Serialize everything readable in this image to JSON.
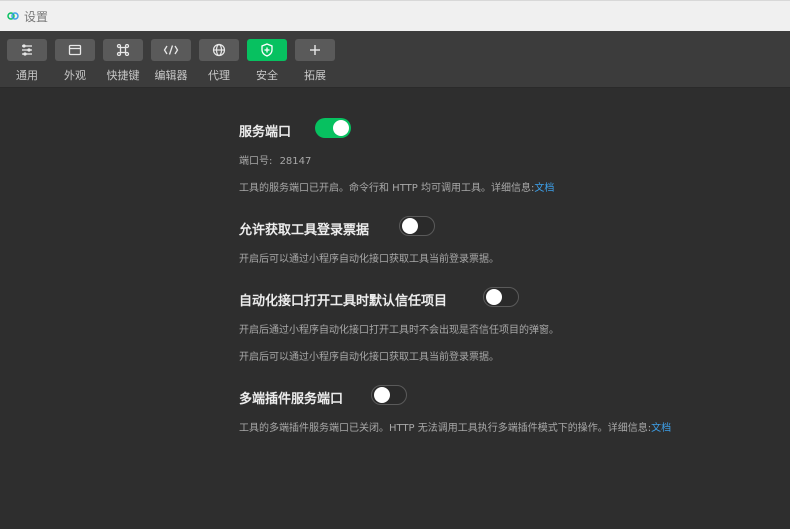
{
  "window": {
    "title": "设置"
  },
  "toolbar": {
    "items": [
      {
        "label": "通用",
        "icon": "list-settings-icon",
        "active": false
      },
      {
        "label": "外观",
        "icon": "window-icon",
        "active": false
      },
      {
        "label": "快捷键",
        "icon": "command-key-icon",
        "active": false
      },
      {
        "label": "编辑器",
        "icon": "code-icon",
        "active": false
      },
      {
        "label": "代理",
        "icon": "globe-icon",
        "active": false
      },
      {
        "label": "安全",
        "icon": "shield-icon",
        "active": true
      },
      {
        "label": "拓展",
        "icon": "plus-icon",
        "active": false
      }
    ]
  },
  "colors": {
    "accent": "#07c160",
    "link": "#3d9fe8",
    "background": "#2e2e2e",
    "toolbar": "#3c3c3c"
  },
  "settings": {
    "service_port": {
      "title": "服务端口",
      "enabled": true,
      "port_label": "端口号:",
      "port_value": "28147",
      "desc": "工具的服务端口已开启。命令行和 HTTP 均可调用工具。详细信息:",
      "link": "文档"
    },
    "login_ticket": {
      "title": "允许获取工具登录票据",
      "enabled": false,
      "desc": "开启后可以通过小程序自动化接口获取工具当前登录票据。"
    },
    "auto_trust": {
      "title": "自动化接口打开工具时默认信任项目",
      "enabled": false,
      "desc1": "开启后通过小程序自动化接口打开工具时不会出现是否信任项目的弹窗。",
      "desc2": "开启后可以通过小程序自动化接口获取工具当前登录票据。"
    },
    "multi_plugin_port": {
      "title": "多端插件服务端口",
      "enabled": false,
      "desc": "工具的多端插件服务端口已关闭。HTTP 无法调用工具执行多端插件模式下的操作。详细信息:",
      "link": "文档"
    }
  }
}
